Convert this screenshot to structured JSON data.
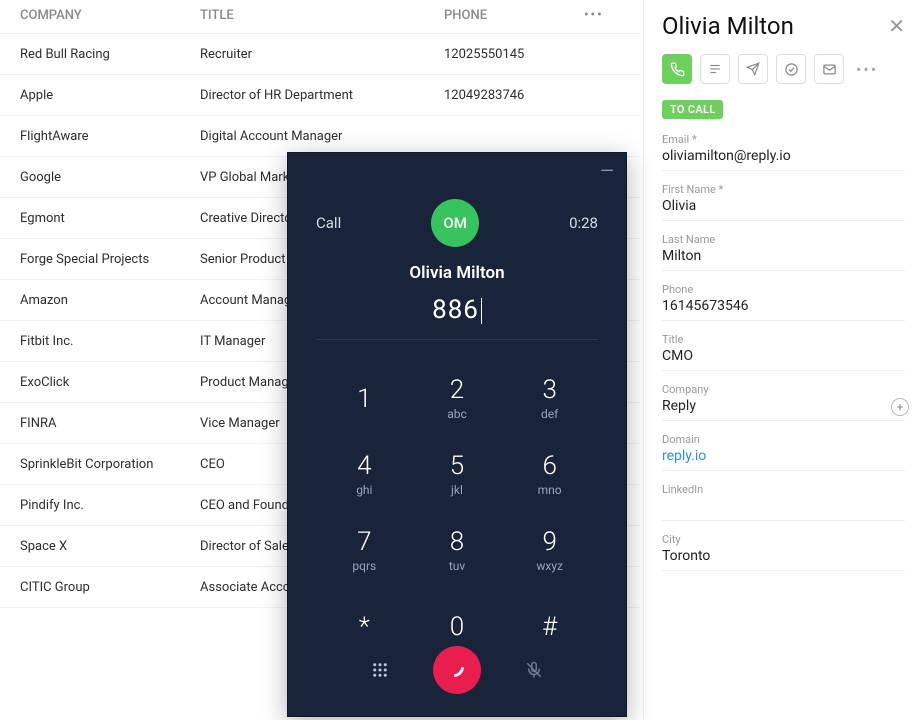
{
  "table": {
    "headers": {
      "company": "COMPANY",
      "title": "TITLE",
      "phone": "PHONE",
      "more": "•••"
    },
    "rows": [
      {
        "company": "Red Bull Racing",
        "title": "Recruiter",
        "phone": "12025550145"
      },
      {
        "company": "Apple",
        "title": "Director of HR Department",
        "phone": "12049283746"
      },
      {
        "company": "FlightAware",
        "title": "Digital Account Manager",
        "phone": ""
      },
      {
        "company": "Google",
        "title": "VP Global Marketing",
        "phone": ""
      },
      {
        "company": "Egmont",
        "title": "Creative Director",
        "phone": ""
      },
      {
        "company": "Forge Special Projects",
        "title": "Senior Product",
        "phone": ""
      },
      {
        "company": "Amazon",
        "title": "Account Manager",
        "phone": ""
      },
      {
        "company": "Fitbit Inc.",
        "title": "IT Manager",
        "phone": ""
      },
      {
        "company": "ExoClick",
        "title": "Product Manager",
        "phone": ""
      },
      {
        "company": "FINRA",
        "title": "Vice Manager",
        "phone": ""
      },
      {
        "company": "SprinkleBit Corporation",
        "title": "CEO",
        "phone": ""
      },
      {
        "company": "Pindify Inc.",
        "title": "CEO and Founder",
        "phone": ""
      },
      {
        "company": "Space X",
        "title": "Director of Sales",
        "phone": ""
      },
      {
        "company": "CITIC Group",
        "title": "Associate Account",
        "phone": ""
      }
    ]
  },
  "panel": {
    "name": "Olivia Milton",
    "status": "TO CALL",
    "fields": {
      "email_label": "Email *",
      "email": "oliviamilton@reply.io",
      "firstname_label": "First Name *",
      "firstname": "Olivia",
      "lastname_label": "Last Name",
      "lastname": "Milton",
      "phone_label": "Phone",
      "phone": "16145673546",
      "title_label": "Title",
      "title": "CMO",
      "company_label": "Company",
      "company": "Reply",
      "domain_label": "Domain",
      "domain": "reply.io",
      "linkedin_label": "LinkedIn",
      "linkedin": "",
      "city_label": "City",
      "city": "Toronto"
    }
  },
  "dialer": {
    "call_label": "Call",
    "timer": "0:28",
    "initials": "OM",
    "name": "Olivia Milton",
    "number": "886",
    "keys": [
      {
        "d": "1",
        "l": ""
      },
      {
        "d": "2",
        "l": "abc"
      },
      {
        "d": "3",
        "l": "def"
      },
      {
        "d": "4",
        "l": "ghi"
      },
      {
        "d": "5",
        "l": "jkl"
      },
      {
        "d": "6",
        "l": "mno"
      },
      {
        "d": "7",
        "l": "pqrs"
      },
      {
        "d": "8",
        "l": "tuv"
      },
      {
        "d": "9",
        "l": "wxyz"
      },
      {
        "d": "*",
        "l": ""
      },
      {
        "d": "0",
        "l": ""
      },
      {
        "d": "#",
        "l": ""
      }
    ]
  }
}
